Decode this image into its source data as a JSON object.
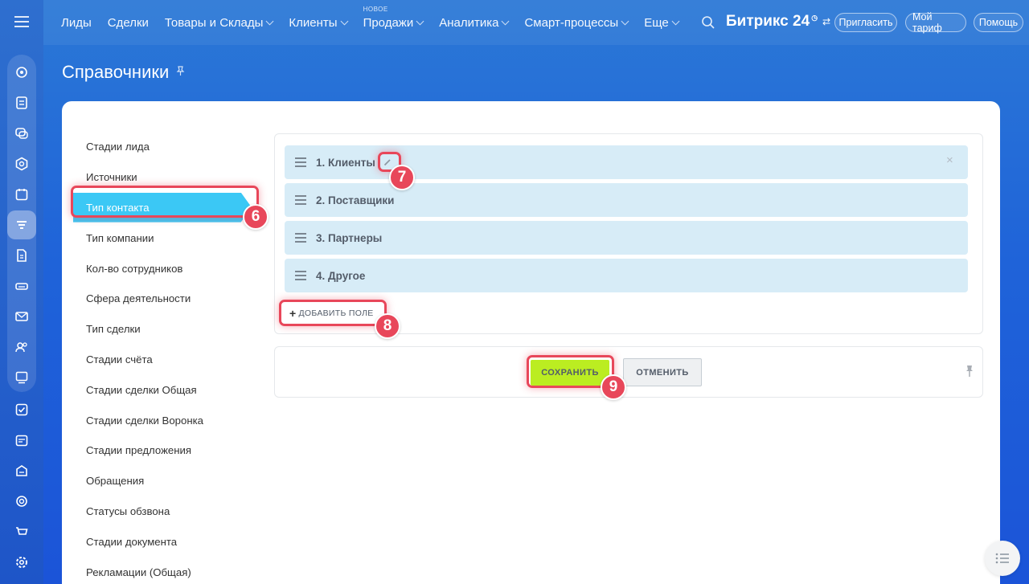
{
  "nav": {
    "items": [
      {
        "label": "Лиды",
        "dropdown": false,
        "badge": ""
      },
      {
        "label": "Сделки",
        "dropdown": false,
        "badge": ""
      },
      {
        "label": "Товары и Склады",
        "dropdown": true,
        "badge": ""
      },
      {
        "label": "Клиенты",
        "dropdown": true,
        "badge": ""
      },
      {
        "label": "Продажи",
        "dropdown": true,
        "badge": "НОВОЕ"
      },
      {
        "label": "Аналитика",
        "dropdown": true,
        "badge": ""
      },
      {
        "label": "Смарт-процессы",
        "dropdown": true,
        "badge": ""
      },
      {
        "label": "Еще",
        "dropdown": true,
        "badge": ""
      }
    ],
    "brand": "Битрикс",
    "brand_number": "24",
    "buttons": {
      "invite": "Пригласить",
      "tariff": "Мой тариф",
      "help": "Помощь"
    }
  },
  "page": {
    "title": "Справочники"
  },
  "side_menu": [
    "Стадии лида",
    "Источники",
    "Тип контакта",
    "Тип компании",
    "Кол-во сотрудников",
    "Сфера деятельности",
    "Тип сделки",
    "Стадии счёта",
    "Стадии сделки Общая",
    "Стадии сделки Воронка",
    "Стадии предложения",
    "Обращения",
    "Статусы обзвона",
    "Стадии документа",
    "Рекламации (Общая)"
  ],
  "side_menu_active": "Тип контакта",
  "fields": [
    "1. Клиенты",
    "2. Поставщики",
    "3. Партнеры",
    "4. Другое"
  ],
  "add_field_label": "ДОБАВИТЬ ПОЛЕ",
  "actions": {
    "save": "СОХРАНИТЬ",
    "cancel": "ОТМЕНИТЬ"
  },
  "markers": {
    "side_active": "6",
    "edit": "7",
    "add": "8",
    "save": "9"
  },
  "colors": {
    "active_item": "#3bc8f5",
    "save_button": "#bbed21",
    "marker": "#e8475a",
    "field_bg": "#d7ecf7"
  }
}
